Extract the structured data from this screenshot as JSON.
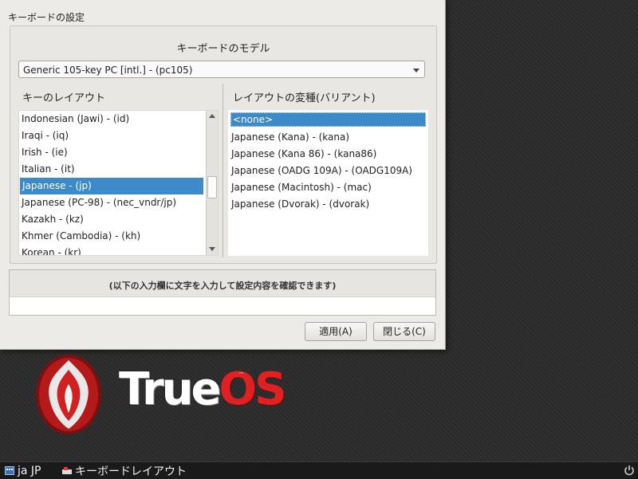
{
  "dialog": {
    "title": "キーボードの設定",
    "model_section_title": "キーボードのモデル",
    "model_value": "Generic 105-key PC [intl.] - (pc105)",
    "layout_title": "キーのレイアウト",
    "variant_title": "レイアウトの変種(バリアント)",
    "layouts": [
      "Indonesian (Jawi) - (id)",
      "Iraqi - (iq)",
      "Irish - (ie)",
      "Italian - (it)",
      "Japanese - (jp)",
      "Japanese (PC-98) - (nec_vndr/jp)",
      "Kazakh - (kz)",
      "Khmer (Cambodia) - (kh)",
      "Korean - (kr)"
    ],
    "selected_layout": "Japanese - (jp)",
    "variants": [
      "<none>",
      "Japanese (Kana) - (kana)",
      "Japanese (Kana 86) - (kana86)",
      "Japanese (OADG 109A) - (OADG109A)",
      "Japanese (Macintosh) - (mac)",
      "Japanese (Dvorak) - (dvorak)"
    ],
    "selected_variant": "<none>",
    "test_label": "(以下の入力欄に文字を入力して設定内容を確認できます)",
    "test_value": "",
    "apply_button": "適用(A)",
    "close_button": "閉じる(C)"
  },
  "logo": {
    "text_true": "True",
    "text_os": "OS",
    "trademark": "™"
  },
  "taskbar": {
    "item1_label": "ja JP",
    "item2_label": "キーボードレイアウト"
  },
  "colors": {
    "selection": "#3c8ac8",
    "brand_red": "#e02121"
  },
  "icons": [
    "chevron-down-icon",
    "scroll-up-icon",
    "scroll-down-icon",
    "flame-logo-icon",
    "keyboard-icon",
    "power-icon"
  ]
}
